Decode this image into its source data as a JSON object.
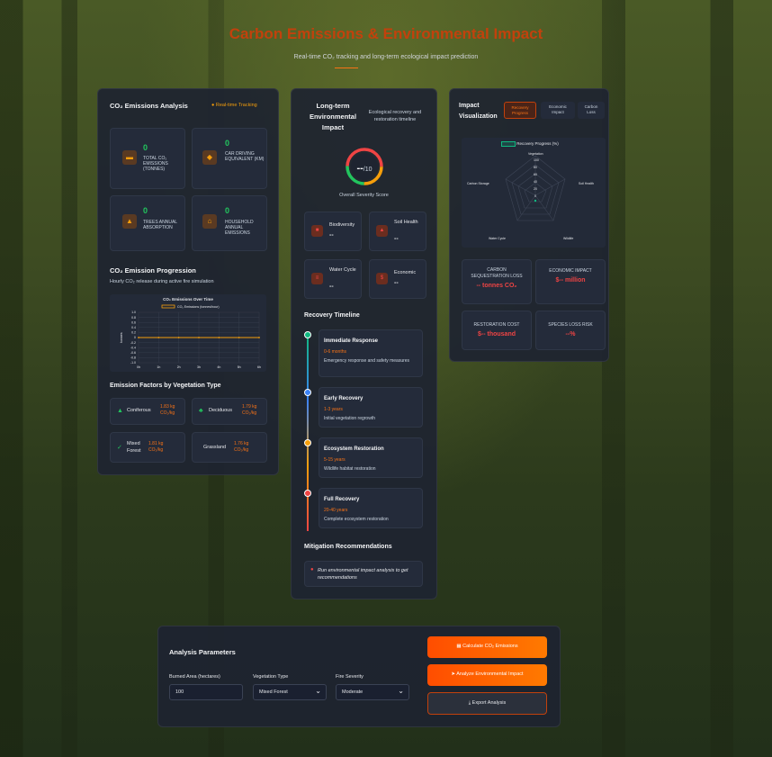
{
  "header": {
    "title": "Carbon Emissions & Environmental Impact",
    "subtitle": "Real-time CO₂ tracking and long-term ecological impact prediction"
  },
  "emissions": {
    "title": "CO₂ Emissions Analysis",
    "badge": "Real-time Tracking",
    "stats": [
      {
        "value": "0",
        "label": "TOTAL CO₂ EMISSIONS (TONNES)",
        "icon": "truck-icon"
      },
      {
        "value": "0",
        "label": "CAR DRIVING EQUIVALENT (KM)",
        "icon": "car-icon"
      },
      {
        "value": "0",
        "label": "TREES ANNUAL ABSORPTION",
        "icon": "bell-icon"
      },
      {
        "value": "0",
        "label": "HOUSEHOLD ANNUAL EMISSIONS",
        "icon": "home-icon"
      }
    ],
    "progression_title": "CO₂ Emission Progression",
    "progression_subtitle": "Hourly CO₂ release during active fire simulation",
    "factors_title": "Emission Factors by Vegetation Type",
    "factors": [
      {
        "name": "Coniferous",
        "value": "1.83 kg CO₂/kg"
      },
      {
        "name": "Deciduous",
        "value": "1.79 kg CO₂/kg"
      },
      {
        "name": "Mixed Forest",
        "value": "1.81 kg CO₂/kg"
      },
      {
        "name": "Grassland",
        "value": "1.76 kg CO₂/kg"
      }
    ]
  },
  "chart_data": {
    "type": "line",
    "title": "CO₂ Emissions Over Time",
    "series": [
      {
        "name": "CO₂ Emissions (tonnes/hour)",
        "values": [
          0,
          0,
          0,
          0,
          0,
          0,
          0
        ]
      }
    ],
    "x": [
      "0h",
      "1h",
      "2h",
      "3h",
      "4h",
      "5h",
      "6h"
    ],
    "yticks": [
      "1.0",
      "0.8",
      "0.6",
      "0.4",
      "0.2",
      "0",
      "-0.2",
      "-0.4",
      "-0.6",
      "-0.8",
      "-1.0"
    ],
    "ylim": [
      -1,
      1
    ],
    "ylabel": "tonnes",
    "grid": true,
    "color": "#f59e0b"
  },
  "longterm": {
    "title": "Long-term Environmental Impact",
    "subtitle": "Ecological recovery and restoration timeline",
    "score": "--",
    "score_max": "/10",
    "score_label": "Overall Severity Score",
    "metrics": [
      {
        "label": "Biodiversity",
        "value": "--"
      },
      {
        "label": "Soil Health",
        "value": "--"
      },
      {
        "label": "Water Cycle",
        "value": "--"
      },
      {
        "label": "Economic",
        "value": "--"
      }
    ],
    "timeline_title": "Recovery Timeline",
    "timeline": [
      {
        "title": "Immediate Response",
        "period": "0-6 months",
        "desc": "Emergency response and safety measures",
        "color": "#10b981"
      },
      {
        "title": "Early Recovery",
        "period": "1-3 years",
        "desc": "Initial vegetation regrowth",
        "color": "#3b82f6"
      },
      {
        "title": "Ecosystem Restoration",
        "period": "5-15 years",
        "desc": "Wildlife habitat restoration",
        "color": "#f59e0b"
      },
      {
        "title": "Full Recovery",
        "period": "20-40 years",
        "desc": "Complete ecosystem restoration",
        "color": "#ef4444"
      }
    ],
    "mitigation_title": "Mitigation Recommendations",
    "mitigation_text": "Run environmental impact analysis to get recommendations"
  },
  "impact": {
    "title": "Impact Visualization",
    "tabs": [
      "Recovery Progress",
      "Economic Impact",
      "Carbon Loss"
    ],
    "radar": {
      "legend": "Recovery Progress (%)",
      "axes": [
        "Vegetation",
        "Soil Health",
        "Wildlife",
        "Water Cycle",
        "Carbon Storage"
      ],
      "ticks": [
        "100",
        "80",
        "60",
        "40",
        "20",
        "0"
      ]
    },
    "stats": [
      {
        "label": "CARBON SEQUESTRATION LOSS",
        "value": "-- tonnes CO₂"
      },
      {
        "label": "ECONOMIC IMPACT",
        "value": "$-- million"
      },
      {
        "label": "RESTORATION COST",
        "value": "$-- thousand"
      },
      {
        "label": "SPECIES LOSS RISK",
        "value": "--%"
      }
    ]
  },
  "params": {
    "title": "Analysis Parameters",
    "area_label": "Burned Area (hectares)",
    "area_value": "100",
    "veg_label": "Vegetation Type",
    "veg_value": "Mixed Forest",
    "sev_label": "Fire Severity",
    "sev_value": "Moderate",
    "btn_calc": "Calculate CO₂ Emissions",
    "btn_analyze": "Analyze Environmental Impact",
    "btn_export": "Export Analysis"
  }
}
